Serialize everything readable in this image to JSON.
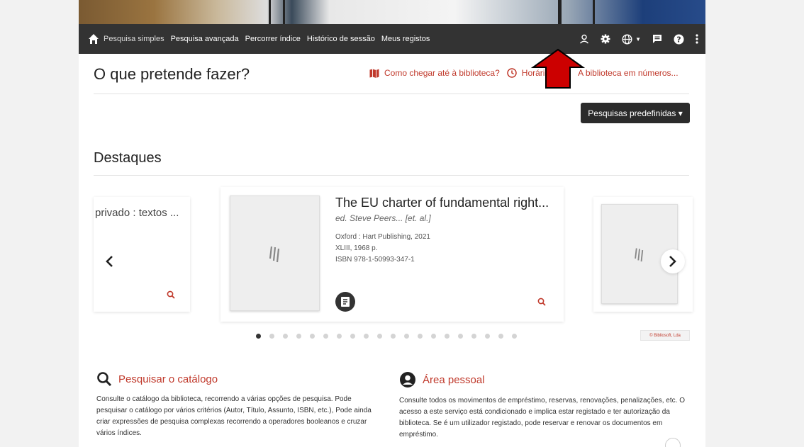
{
  "nav": {
    "items": [
      "Pesquisa simples",
      "Pesquisa avançada",
      "Percorrer índice",
      "Histórico de sessão",
      "Meus registos"
    ]
  },
  "icons": {
    "home": "home-icon",
    "user": "user-icon",
    "settings": "gear-icon",
    "language": "globe-icon",
    "messages": "message-icon",
    "help": "help-icon",
    "more": "more-vertical-icon"
  },
  "main": {
    "heading": "O que pretende fazer?",
    "quick_links": [
      "Como chegar até à biblioteca?",
      "Horário",
      "A biblioteca em números..."
    ],
    "predefined_button": "Pesquisas predefinidas",
    "highlights_heading": "Destaques"
  },
  "carousel": {
    "left_card_title": "privado : textos ...",
    "main_card": {
      "title": "The EU charter of fundamental right...",
      "authors": "ed. Steve Peers... [et. al.]",
      "publisher": "Oxford : Hart Publishing, 2021",
      "pages": "XLIII, 1968 p.",
      "isbn": "ISBN 978-1-50993-347-1"
    },
    "dot_count": 20,
    "active_dot": 0,
    "copyright": "© Bibliosoft, Lda"
  },
  "sections": [
    {
      "title": "Pesquisar o catálogo",
      "text": "Consulte o catálogo da biblioteca, recorrendo a várias opções de pesquisa. Pode pesquisar o catálogo por vários critérios (Autor, Título, Assunto, ISBN, etc.), Pode ainda criar expressões de pesquisa complexas recorrendo a operadores booleanos e cruzar vários índices."
    },
    {
      "title": "Área pessoal",
      "text": "Consulte todos os movimentos de empréstimo, reservas, renovações, penalizações, etc. O acesso a este serviço está condicionado e implica estar registado e ter autorização da biblioteca. Se é um utilizador registado, pode reservar e renovar os documentos em empréstimo."
    }
  ],
  "colors": {
    "accent": "#c0392b",
    "nav_bg": "#333333",
    "arrow": "#cc0000"
  }
}
